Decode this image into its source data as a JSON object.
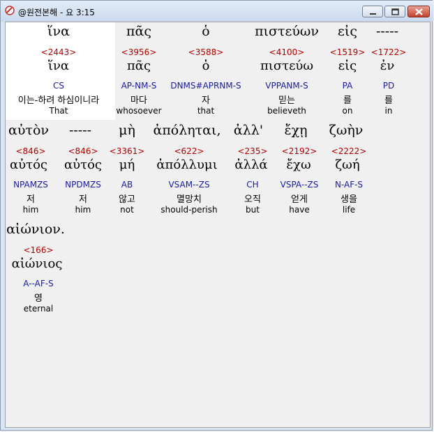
{
  "window": {
    "title": "@원전본해 - 요 3:15"
  },
  "words": [
    {
      "greek": "ἵνα",
      "strong": "<2443>",
      "lemma": "ἵνα",
      "parse": "CS",
      "korean": "이는-하려 하심이니라",
      "english": "That"
    },
    {
      "greek": "πᾶς",
      "strong": "<3956>",
      "lemma": "πᾶς",
      "parse": "AP-NM-S",
      "korean": "마다",
      "english": "whosoever"
    },
    {
      "greek": "ὁ",
      "strong": "<3588>",
      "lemma": "ὁ",
      "parse": "DNMS#APRNM-S",
      "korean": "자",
      "english": "that"
    },
    {
      "greek": "πιστεύων",
      "strong": "<4100>",
      "lemma": "πιστεύω",
      "parse": "VPPANM-S",
      "korean": "믿는",
      "english": "believeth"
    },
    {
      "greek": "εἰς",
      "strong": "<1519>",
      "lemma": "εἰς",
      "parse": "PA",
      "korean": "를",
      "english": "on"
    },
    {
      "greek": "-----",
      "strong": "<1722>",
      "lemma": "ἐν",
      "parse": "PD",
      "korean": "를",
      "english": "in"
    },
    {
      "greek": "αὐτὸν",
      "strong": "<846>",
      "lemma": "αὐτός",
      "parse": "NPAMZS",
      "korean": "저",
      "english": "him"
    },
    {
      "greek": "-----",
      "strong": "<846>",
      "lemma": "αὐτός",
      "parse": "NPDMZS",
      "korean": "저",
      "english": "him"
    },
    {
      "greek": "μὴ",
      "strong": "<3361>",
      "lemma": "μή",
      "parse": "AB",
      "korean": "않고",
      "english": "not"
    },
    {
      "greek": "ἀπόληται,",
      "strong": "<622>",
      "lemma": "ἀπόλλυμι",
      "parse": "VSAM--ZS",
      "korean": "멸망치",
      "english": "should-perish"
    },
    {
      "greek": "ἀλλ'",
      "strong": "<235>",
      "lemma": "ἀλλά",
      "parse": "CH",
      "korean": "오직",
      "english": "but"
    },
    {
      "greek": "ἔχῃ",
      "strong": "<2192>",
      "lemma": "ἔχω",
      "parse": "VSPA--ZS",
      "korean": "얻게",
      "english": "have"
    },
    {
      "greek": "ζωὴν",
      "strong": "<2222>",
      "lemma": "ζωή",
      "parse": "N-AF-S",
      "korean": "생을",
      "english": "life"
    },
    {
      "greek": "αἰώνιον.",
      "strong": "<166>",
      "lemma": "αἰώνιος",
      "parse": "A--AF-S",
      "korean": "영",
      "english": "eternal"
    }
  ]
}
